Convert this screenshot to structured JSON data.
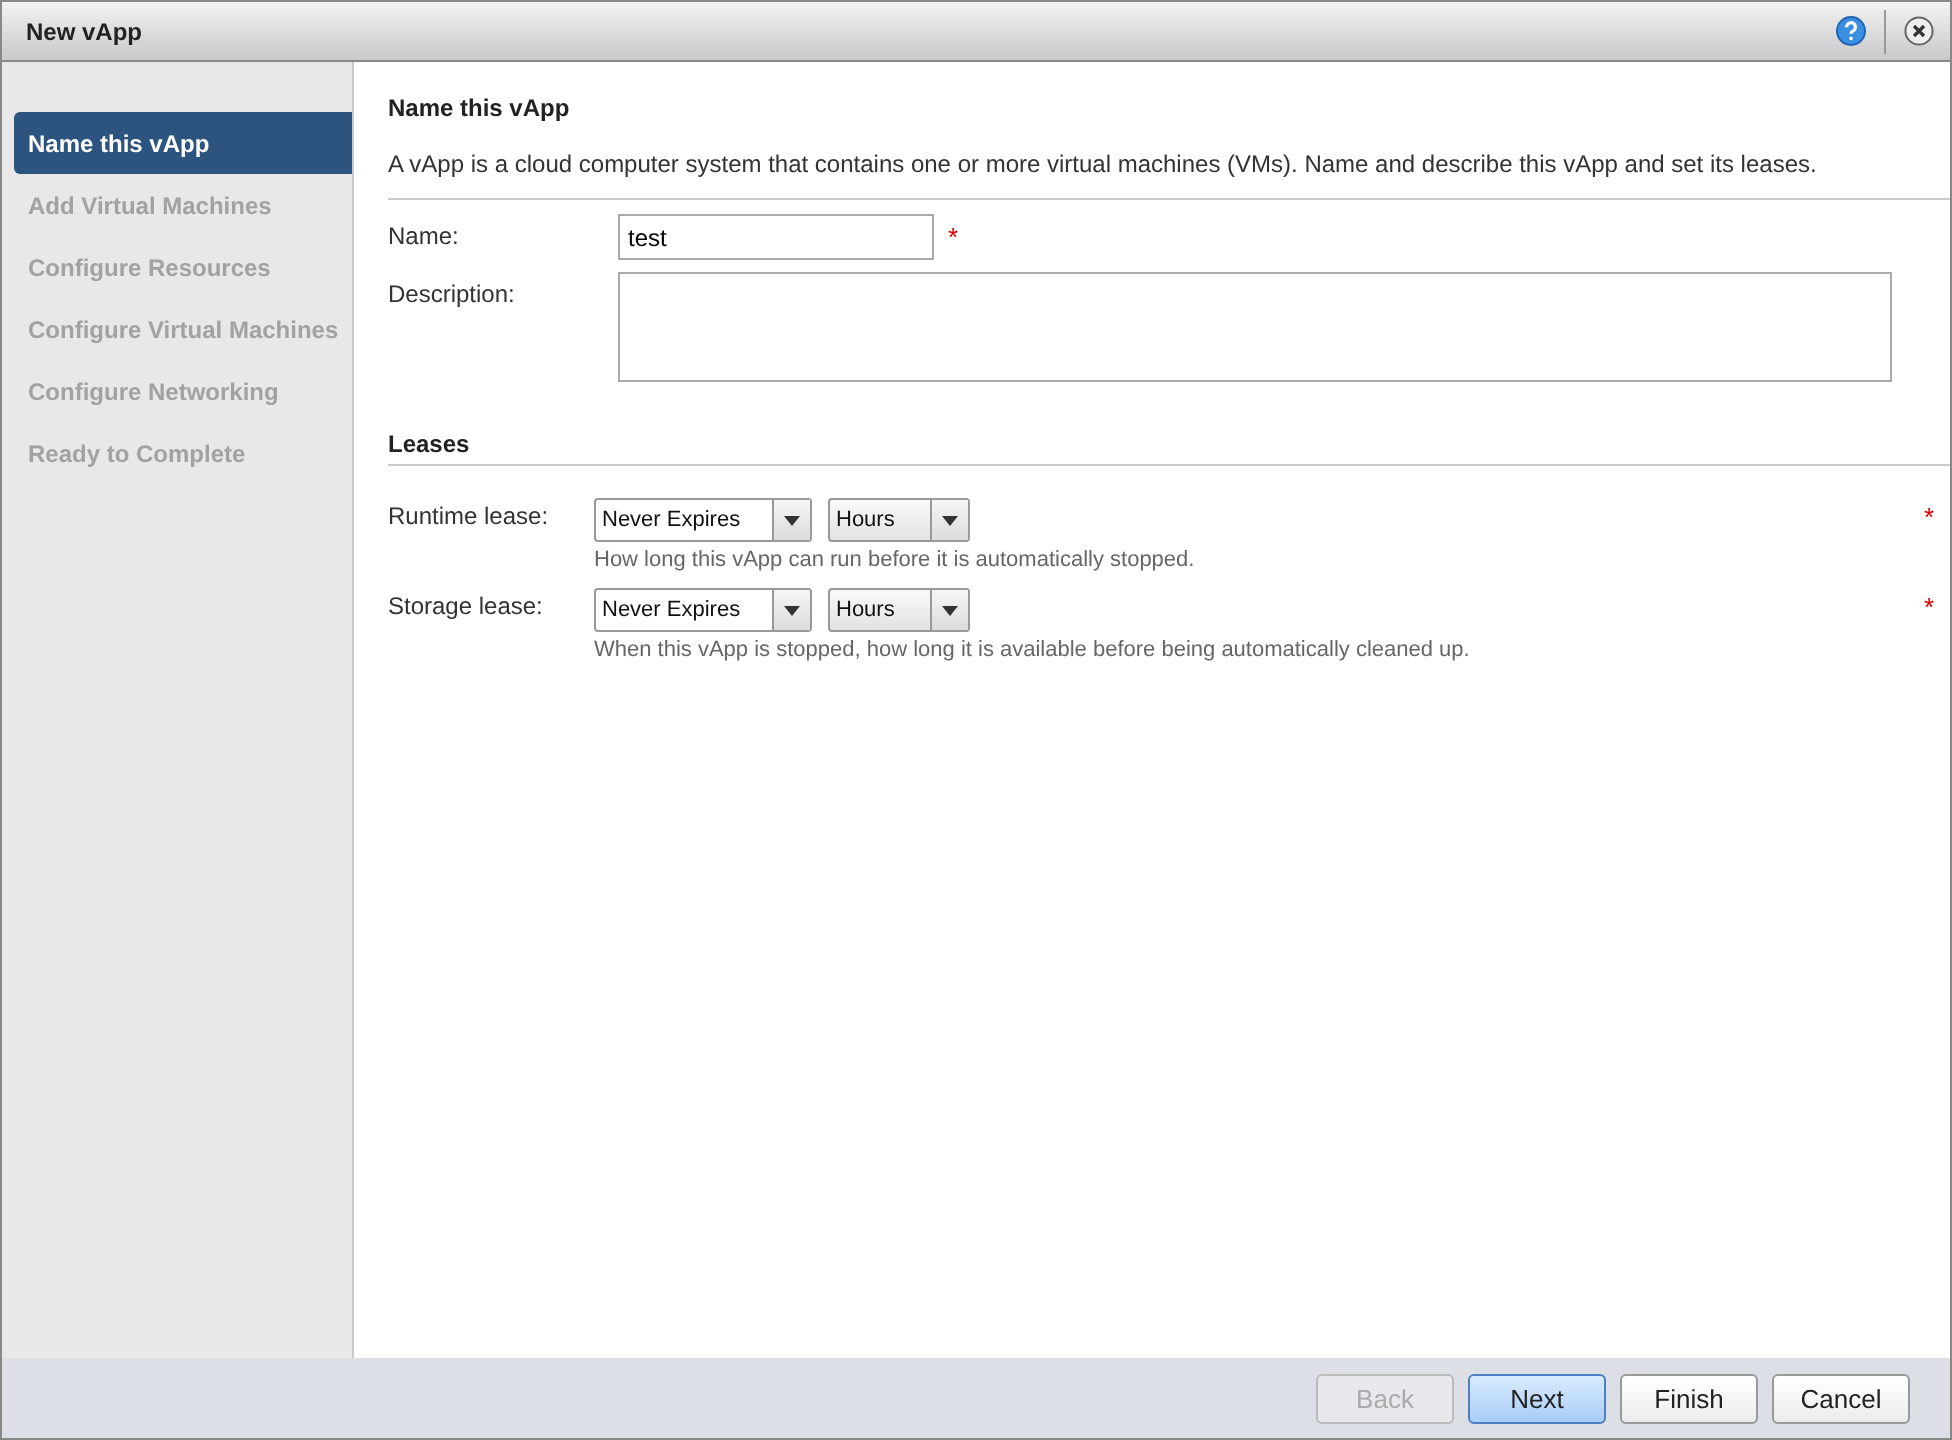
{
  "window": {
    "title": "New vApp"
  },
  "steps": [
    {
      "label": "Name this vApp",
      "selected": true
    },
    {
      "label": "Add Virtual Machines",
      "selected": false
    },
    {
      "label": "Configure Resources",
      "selected": false
    },
    {
      "label": "Configure Virtual Machines",
      "selected": false
    },
    {
      "label": "Configure Networking",
      "selected": false
    },
    {
      "label": "Ready to Complete",
      "selected": false
    }
  ],
  "page": {
    "heading": "Name this vApp",
    "intro": "A vApp is a cloud computer system that contains one or more virtual machines (VMs). Name and describe this vApp and set its leases.",
    "name": {
      "label": "Name:",
      "value": "test",
      "required": "*"
    },
    "description": {
      "label": "Description:"
    },
    "leases": {
      "heading": "Leases",
      "rows": [
        {
          "label": "Runtime lease:",
          "duration": "Never Expires",
          "unit": "Hours",
          "hint": "How long this vApp can run before it is automatically stopped.",
          "required": "*"
        },
        {
          "label": "Storage lease:",
          "duration": "Never Expires",
          "unit": "Hours",
          "hint": "When this vApp is stopped, how long it is available before being automatically cleaned up.",
          "required": "*"
        }
      ]
    }
  },
  "buttons": [
    {
      "label": "Back",
      "kind": "normal",
      "disabled": true
    },
    {
      "label": "Next",
      "kind": "primary",
      "disabled": false
    },
    {
      "label": "Finish",
      "kind": "normal",
      "disabled": false
    },
    {
      "label": "Cancel",
      "kind": "normal",
      "disabled": false
    }
  ]
}
